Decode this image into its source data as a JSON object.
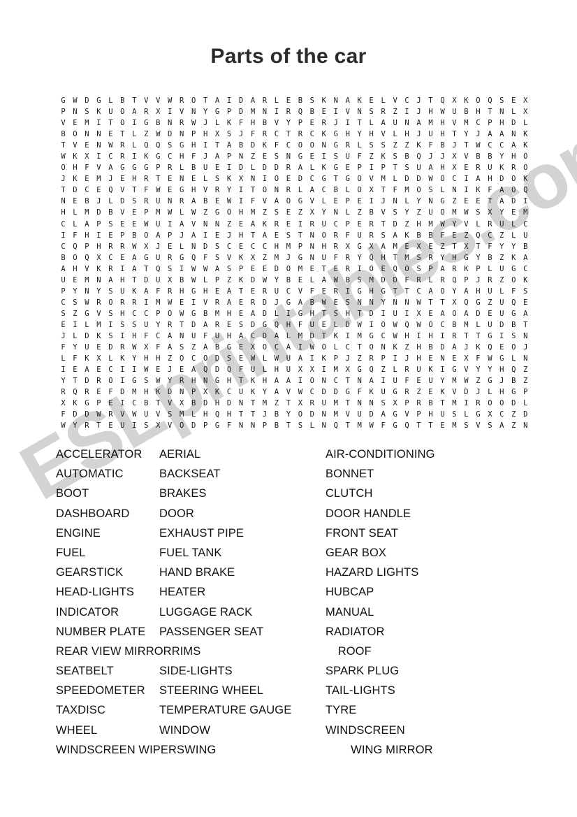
{
  "title": "Parts of the car",
  "watermark": "ESLprintables.com",
  "colors": {
    "title": "#2b2b2b",
    "grid_letter": "#1a1a1a",
    "word": "#111111",
    "watermark": "#cccccc",
    "page_background": "#ffffff"
  },
  "grid": {
    "columns": 39,
    "rows_count": 30,
    "rows": [
      "GWDGLBTVVWROTAIDARLEBSKNAKELVCJTQXKOQSEX",
      "PNSKUOARXIVNYGPDMNIRQBEIVNSRZIJHWUBHTNLX",
      "VEMITOIGBNRWJLKFHBVYPERJITLAUNAMHVMCPHDL",
      "BONNETLZWDNPHXSJFRCTRCKGHYHVLHJUHTYJAANK",
      "TVENWRLQQSGHITABDKFCOONGRLSSZZKFBJTWCCAK",
      "WKXICRIKGCHFJAPNZESNGEISUFZKSBQJJXVBBYHO",
      "OHFVAGGGPRLBUEIDLDDRALKGEPIPTSUAHXERUKRO",
      "JKEMJEHRTENELSKXNIOEDCGTGOVMLDDWOCIAHDOK",
      "TDCEQVTFWEGHVRYITONRLACBLOXTFMOSLNIKFAOQ",
      "NEBJLDSRUNRABEWIFVAOGVLEPEIJNLYNGZEETADI",
      "HLMDBVEPMWLWZGOHMZSEZXYNLZBVSYZUOMWSXYEM",
      "CLAPSEEWUIAVNNZEAKREIRUCPERTDZHMWYVLRULC",
      "IFHIEPBOAPJAIEJHTAESTNORFURSAKBBFEZQCZLU",
      "CQPHRRWXJELNDSCECCHMPNHRXGXAMEXEZTXTFYYB",
      "BOQXCEAGURGQFSVKXZMJGNUFRYQHTMSRYHGYBZKA",
      "AHVKRIATQSIWWASPEEDOMETERIOEQOSPARKPLUGC",
      "UEMNAHTDUXBWLPZKDWYBELAWBSMDDFRLRQPJRZOK",
      "PYNYSUKAFRHGHEATERUCVFERIGHGTTCAOYAHULFS",
      "CSWRORRIMWEIVRAERDJGABWESNNYNNWTTXQGZUQE",
      "SZGVSHCCPOWGBMHEADLIGHTSHTDIUIXEAOADEUGA",
      "EILMISSUYRTDARESDGQHFUELDWIOWQWOCBMLUDBT",
      "JLDKSIHFCANUFUHACDALMDTKIMGCWHIHIRTTGISN",
      "FYUEDRWXFASZABGEXOCAIWOLCTONKZHBDAJKQEOJ",
      "LFKXLKYHHZOCODSEWLWUAIKPJZRPIJHENEXFWGLN",
      "IEAECIIWEJEAQDQFULHUXXIMXGQZLRUKIGVYYHQZ",
      "YTDROIGSWYRHNGHTKHAAIONCTNAIUFEUYMWZGJBZ",
      "RQREFDMHKDNPXKCUKYAVWCDDGFKUGRZEKVDJLHGP",
      "XKGPEICBTVXBDHDNTMZTXRUMTNNSXPRBTMIROODL",
      "FDDWRVWUVSMLHQHTTJBYODNMVUDAGVPHUSLGXCZD",
      "WYRTEUISXVODPGFNNPBTSLNQTMWFGQTTEMSVSAZN"
    ]
  },
  "word_list": {
    "columns": 3,
    "rows": [
      [
        "ACCELERATOR",
        "AERIAL",
        "AIR-CONDITIONING"
      ],
      [
        "AUTOMATIC",
        "BACKSEAT",
        "BONNET"
      ],
      [
        "BOOT",
        "BRAKES",
        "CLUTCH"
      ],
      [
        "DASHBOARD",
        "DOOR",
        "DOOR HANDLE"
      ],
      [
        "ENGINE",
        "EXHAUST PIPE",
        "FRONT SEAT"
      ],
      [
        "FUEL",
        "FUEL TANK",
        "GEAR BOX"
      ],
      [
        "GEARSTICK",
        "HAND BRAKE",
        "HAZARD LIGHTS"
      ],
      [
        "HEAD-LIGHTS",
        "HEATER",
        "HUBCAP"
      ],
      [
        "INDICATOR",
        "LUGGAGE RACK",
        "MANUAL"
      ],
      [
        "NUMBER PLATE",
        "PASSENGER SEAT",
        "RADIATOR"
      ],
      [
        "REAR VIEW MIRROR",
        "RIMS",
        "ROOF"
      ],
      [
        "SEATBELT",
        "SIDE-LIGHTS",
        "SPARK PLUG"
      ],
      [
        "SPEEDOMETER",
        "STEERING WHEEL",
        "TAIL-LIGHTS"
      ],
      [
        "TAXDISC",
        "TEMPERATURE GAUGE",
        "TYRE"
      ],
      [
        "WHEEL",
        "WINDOW",
        "WINDSCREEN"
      ],
      [
        "WINDSCREEN WIPERS",
        "WING",
        "WING MIRROR"
      ]
    ]
  }
}
